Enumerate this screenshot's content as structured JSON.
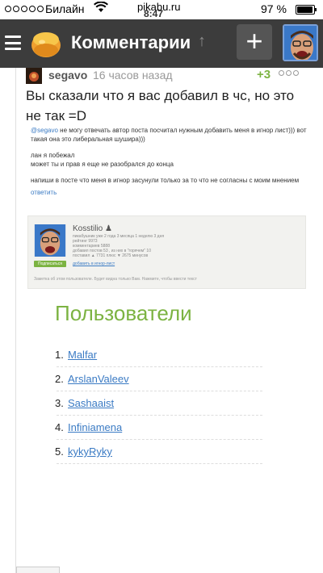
{
  "status": {
    "carrier": "Билайн",
    "url": "pikabu.ru",
    "time": "8:47",
    "battery": "97 %",
    "battery_level": 0.97,
    "signal_bars_filled": 0
  },
  "appbar": {
    "title": "Комментарии",
    "up_icon": "↑",
    "add_icon": "+"
  },
  "comment": {
    "author": "segavo",
    "time": "16 часов назад",
    "rating": "+3",
    "text": "Вы сказали что я вас добавил в чс, но это не так =D"
  },
  "embed": {
    "mention": "@segavo",
    "line1": " не могу отвечать автор поста посчитал нужным добавить меня в игнор лист))) вот такая она это либеральная шушира)))",
    "line2": "лан я побежал",
    "line3": "может ты и прав я еще не разобрался до конца",
    "line4": "напиши в посте что меня в игнор засунули только за то что не согласны с моим мнением",
    "reply_link": "ответить"
  },
  "profile": {
    "name": "Kosstilio",
    "stats": [
      "пикабушник  уже 2 года 3 месяца 1 неделю 3 дня",
      "рейтинг  9973",
      "комментариев  5888",
      "добавил постов  53 , из них в \"горячем\"  10",
      "поставил  ▲ 7731 плюс  ▼ 2675 минусов"
    ],
    "subscribe": "Подписаться",
    "ignore": "добавить в игнор-лист",
    "note": "Заметка об этом пользователе. Будет видна только Вам. Нажмите, чтобы ввести текст"
  },
  "users": {
    "title": "Пользователи",
    "items": [
      {
        "num": "1.",
        "name": "Malfar"
      },
      {
        "num": "2.",
        "name": "ArslanValeev"
      },
      {
        "num": "3.",
        "name": "Sashaaist"
      },
      {
        "num": "4.",
        "name": "Infiniamena"
      },
      {
        "num": "5.",
        "name": "kykyRyky"
      }
    ]
  },
  "colors": {
    "appbar": "#3c3c3c",
    "accent_green": "#7cb342",
    "link_blue": "#3b7bc4"
  },
  "icons": [
    "menu-icon",
    "pikabu-logo-icon",
    "arrow-up-icon",
    "plus-icon",
    "wifi-icon",
    "more-icon",
    "user-icon"
  ]
}
